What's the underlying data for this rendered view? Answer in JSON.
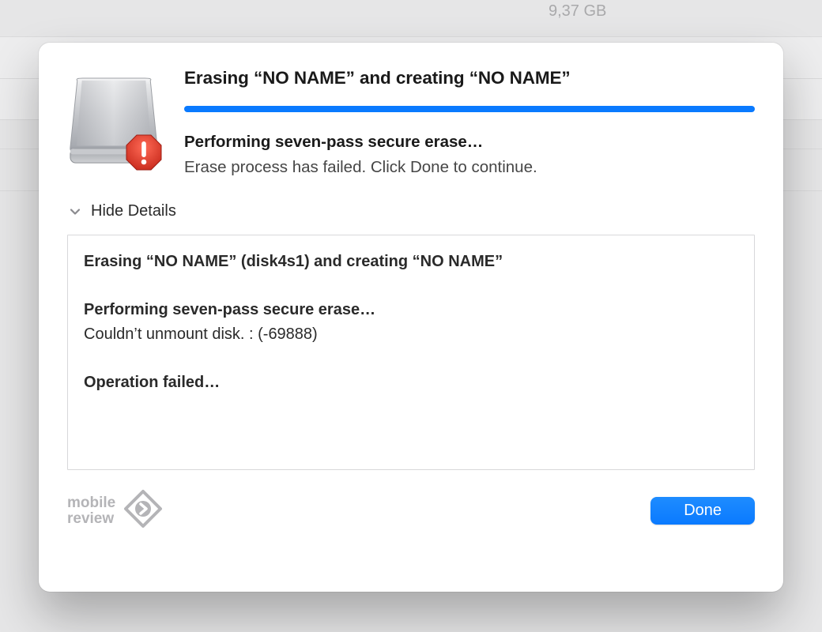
{
  "background": {
    "size_text": "9,37 GB"
  },
  "dialog": {
    "title": "Erasing “NO NAME” and creating “NO NAME”",
    "progress_percent": 100,
    "status": "Performing seven-pass secure erase…",
    "message": "Erase process has failed. Click Done to continue.",
    "details_toggle_label": "Hide Details",
    "log": {
      "line1": "Erasing “NO NAME” (disk4s1) and creating “NO NAME”",
      "line2": "Performing seven-pass secure erase…",
      "line3": "Couldn’t unmount disk. : (-69888)",
      "line4": "Operation failed…"
    },
    "done_label": "Done"
  },
  "watermark": {
    "line1": "mobile",
    "line2": "review"
  },
  "icons": {
    "disk": "hard-drive-icon",
    "alert": "alert-octagon-icon",
    "chevron": "chevron-down-icon",
    "wm": "diamond-arrow-icon"
  },
  "colors": {
    "accent": "#0a7aff",
    "alert": "#d6382a"
  }
}
